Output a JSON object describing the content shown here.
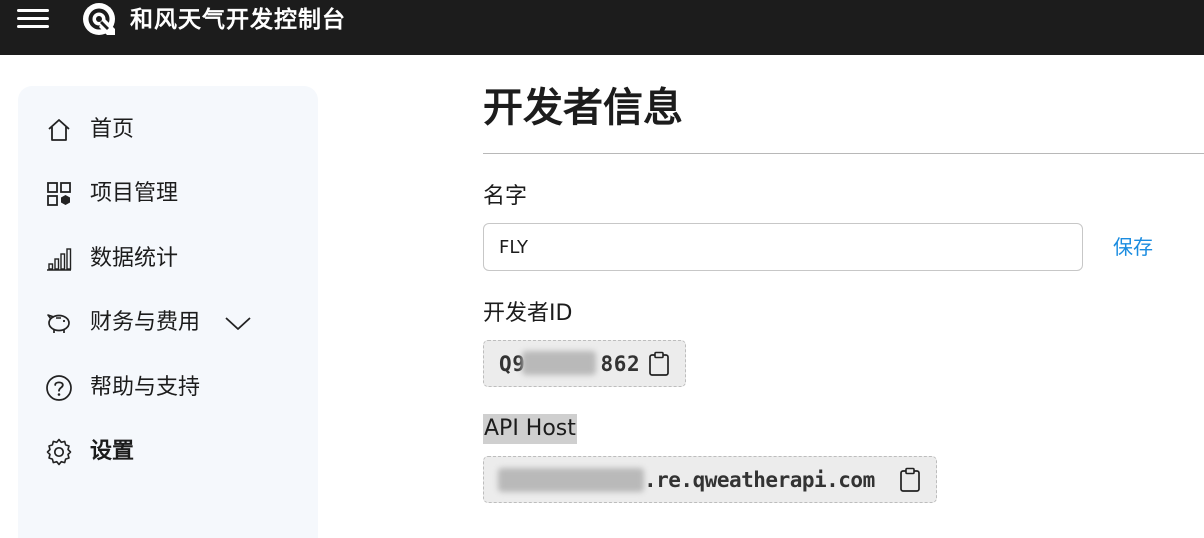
{
  "header": {
    "app_title": "和风天气开发控制台",
    "menu_icon": "hamburger-menu-icon",
    "logo_icon": "swirl-logo-icon"
  },
  "sidebar": {
    "items": [
      {
        "label": "首页",
        "icon": "home-icon",
        "active": false
      },
      {
        "label": "项目管理",
        "icon": "grid-icon",
        "active": false
      },
      {
        "label": "数据统计",
        "icon": "bar-chart-icon",
        "active": false
      },
      {
        "label": "财务与费用",
        "icon": "piggy-bank-icon",
        "active": false,
        "expandable": true,
        "expand_icon": "chevron-down-icon"
      },
      {
        "label": "帮助与支持",
        "icon": "help-icon",
        "active": false
      },
      {
        "label": "设置",
        "icon": "gear-icon",
        "active": true
      }
    ]
  },
  "main": {
    "page_title": "开发者信息",
    "name_field": {
      "label": "名字",
      "value": "FLY",
      "save_label": "保存"
    },
    "developer_id": {
      "label": "开发者ID",
      "visible_start": "Q9",
      "visible_end": "862",
      "copy_icon": "clipboard-icon"
    },
    "api_host": {
      "label": "API Host",
      "visible_suffix": ".re.qweatherapi.com",
      "copy_icon": "clipboard-icon"
    }
  },
  "colors": {
    "topbar_bg": "#1c1c1c",
    "sidebar_bg": "#f5f8fc",
    "link": "#1a8ce0",
    "code_bg": "#ececec"
  }
}
